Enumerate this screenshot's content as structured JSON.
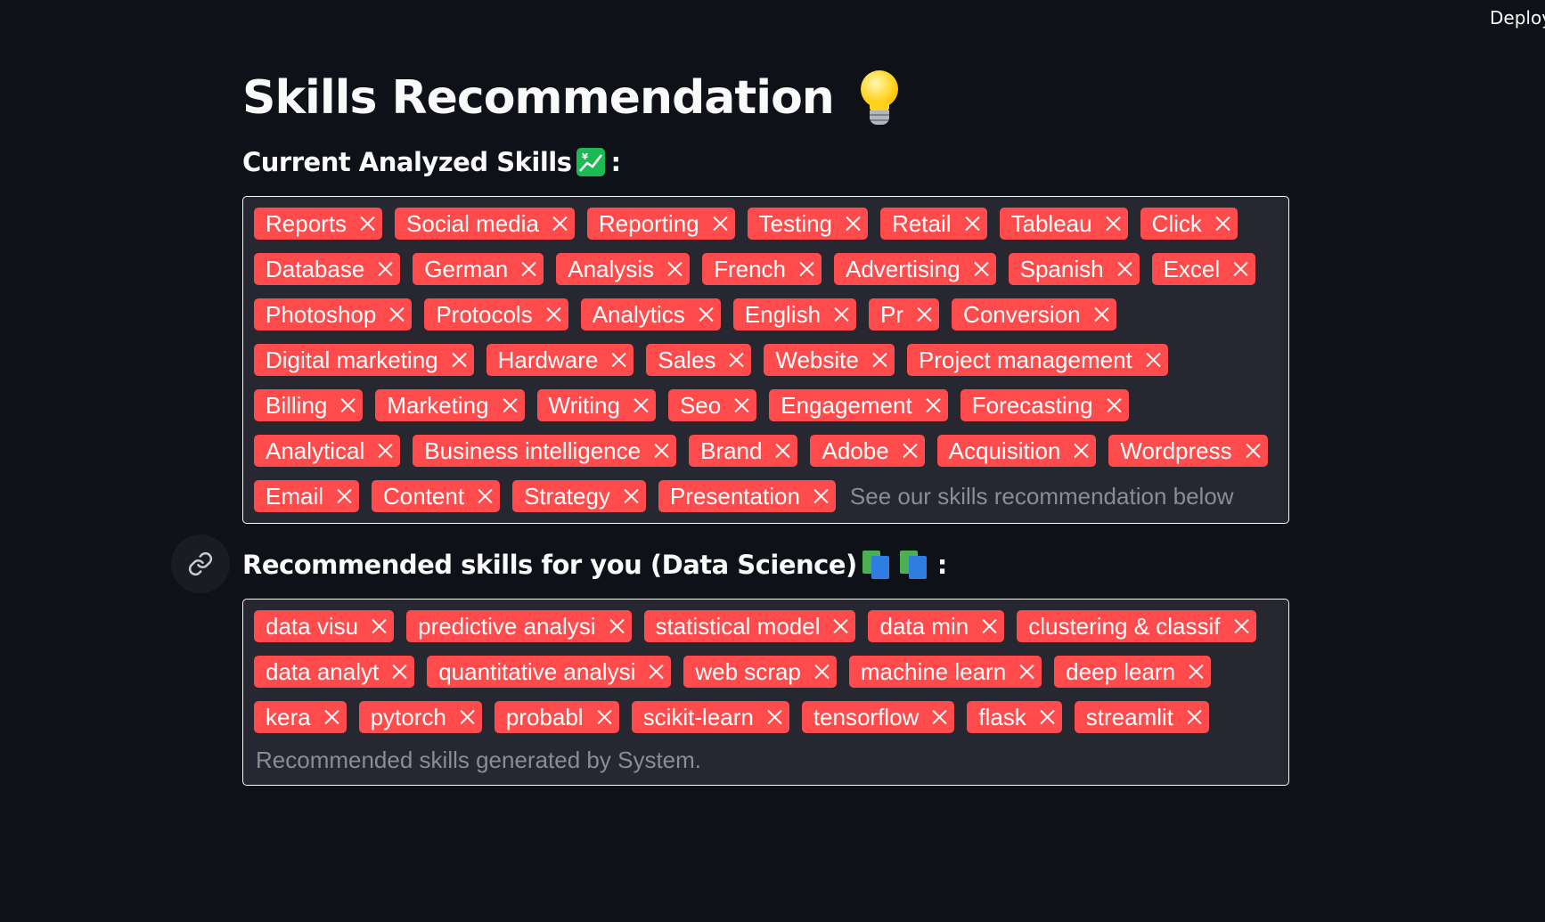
{
  "header": {
    "deploy_label": "Deploy"
  },
  "title": "Skills Recommendation",
  "current": {
    "heading": "Current Analyzed Skills",
    "colon": ":",
    "tags": [
      "Reports",
      "Social media",
      "Reporting",
      "Testing",
      "Retail",
      "Tableau",
      "Click",
      "Database",
      "German",
      "Analysis",
      "French",
      "Advertising",
      "Spanish",
      "Excel",
      "Photoshop",
      "Protocols",
      "Analytics",
      "English",
      "Pr",
      "Conversion",
      "Digital marketing",
      "Hardware",
      "Sales",
      "Website",
      "Project management",
      "Billing",
      "Marketing",
      "Writing",
      "Seo",
      "Engagement",
      "Forecasting",
      "Analytical",
      "Business intelligence",
      "Brand",
      "Adobe",
      "Acquisition",
      "Wordpress",
      "Email",
      "Content",
      "Strategy",
      "Presentation"
    ],
    "placeholder": "See our skills recommendation below"
  },
  "recommended": {
    "heading": "Recommended skills for you (Data Science)",
    "colon": ":",
    "tags": [
      "data visu",
      "predictive analysi",
      "statistical model",
      "data min",
      "clustering & classif",
      "data analyt",
      "quantitative analysi",
      "web scrap",
      "machine learn",
      "deep learn",
      "kera",
      "pytorch",
      "probabl",
      "scikit-learn",
      "tensorflow",
      "flask",
      "streamlit"
    ],
    "placeholder": "Recommended skills generated by System."
  },
  "icons": {
    "title": "light-bulb-icon",
    "current": "chart-increasing-with-yen-icon",
    "recommended": "books-icon",
    "anchor": "link-icon",
    "remove": "close-icon"
  },
  "colors": {
    "background": "#0e1117",
    "tag": "#ff4b4b",
    "box": "#262730",
    "text": "#fafafa",
    "placeholder": "#8b8d94"
  }
}
